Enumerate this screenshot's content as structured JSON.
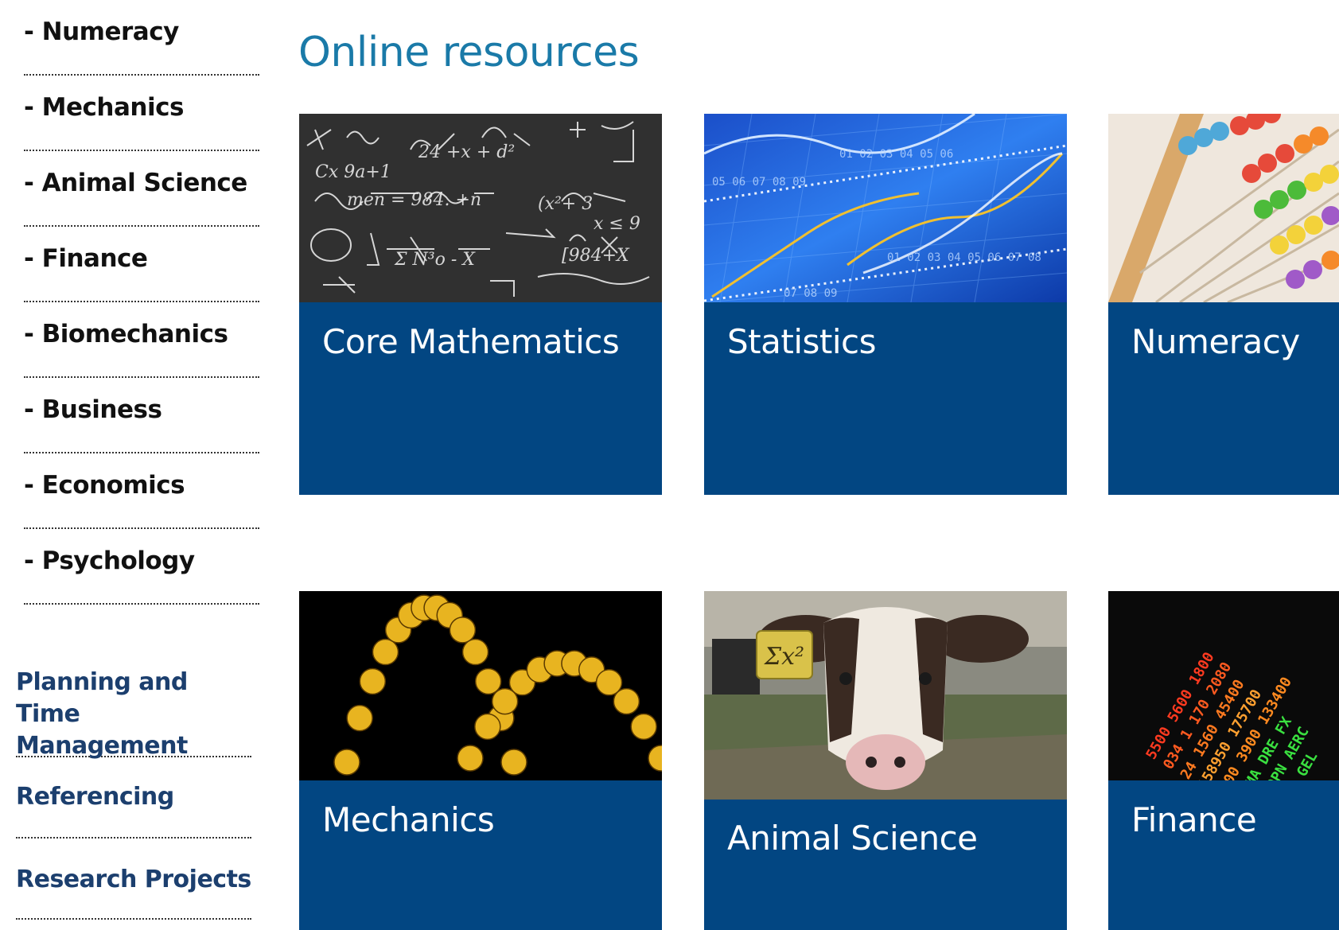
{
  "sidebar": {
    "sub_items": [
      {
        "label": "- Numeracy"
      },
      {
        "label": "- Mechanics"
      },
      {
        "label": "- Animal Science"
      },
      {
        "label": "- Finance"
      },
      {
        "label": "- Biomechanics"
      },
      {
        "label": "- Business"
      },
      {
        "label": "- Economics"
      },
      {
        "label": "- Psychology"
      }
    ],
    "main_items": [
      {
        "label": "Planning and Time Management"
      },
      {
        "label": "Referencing"
      },
      {
        "label": "Research Projects"
      }
    ]
  },
  "main": {
    "title": "Online resources",
    "cards": [
      {
        "label": "Core Mathematics",
        "image": "chalkboard-equations-image"
      },
      {
        "label": "Statistics",
        "image": "blue-stock-chart-image"
      },
      {
        "label": "Numeracy",
        "image": "abacus-image"
      },
      {
        "label": "Mechanics",
        "image": "bouncing-basketball-image"
      },
      {
        "label": "Animal Science",
        "image": "calf-with-ear-tag-image"
      },
      {
        "label": "Finance",
        "image": "stock-ticker-board-image"
      }
    ],
    "ear_tag_text": "Σx²"
  },
  "colors": {
    "card_background": "#024682",
    "title": "#1a7aa8",
    "sidebar_link": "#1c3f6e"
  }
}
